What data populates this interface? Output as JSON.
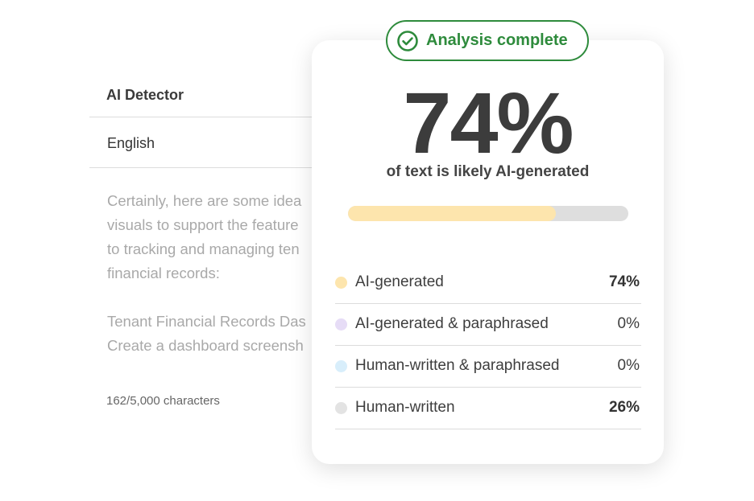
{
  "editor": {
    "tool_title": "AI Detector",
    "language": "English",
    "text_lines": [
      "Certainly, here are some idea",
      "visuals to support the feature",
      "to tracking and managing ten",
      "financial records:",
      "",
      "Tenant Financial Records Das",
      "Create a dashboard screensh"
    ],
    "char_count": "162/5,000 characters"
  },
  "result": {
    "badge_label": "Analysis complete",
    "badge_icon": "check-circle-icon",
    "big_percent": "74%",
    "subtitle": "of text is likely AI-generated",
    "ai_fraction": 0.74,
    "bar_colors": {
      "fill": "#fde5ad",
      "track": "#dedede"
    },
    "accent_color": "#2e8b3c",
    "breakdown": [
      {
        "label": "AI-generated",
        "value": "74%",
        "color": "#fde5ad",
        "bold": true
      },
      {
        "label": "AI-generated & paraphrased",
        "value": "0%",
        "color": "#e6dcf6",
        "bold": false
      },
      {
        "label": "Human-written & paraphrased",
        "value": "0%",
        "color": "#d8eefb",
        "bold": false
      },
      {
        "label": "Human-written",
        "value": "26%",
        "color": "#e3e3e3",
        "bold": true
      }
    ]
  }
}
